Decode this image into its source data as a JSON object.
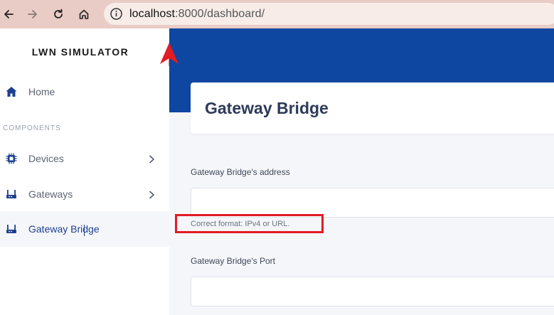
{
  "browser": {
    "url_host": "localhost",
    "url_rest": ":8000/dashboard/",
    "icons": [
      "back-icon",
      "forward-icon",
      "reload-icon",
      "home-icon",
      "info-icon"
    ]
  },
  "sidebar": {
    "brand": "LWN SIMULATOR",
    "section_label": "COMPONENTS",
    "items": [
      {
        "label": "Home",
        "icon": "home-icon",
        "has_chevron": false,
        "active": false
      },
      {
        "label": "Devices",
        "icon": "chip-icon",
        "has_chevron": true,
        "active": false
      },
      {
        "label": "Gateways",
        "icon": "router-icon",
        "has_chevron": true,
        "active": false
      },
      {
        "label": "Gateway Bridge",
        "icon": "router-icon",
        "has_chevron": false,
        "active": true
      }
    ]
  },
  "main": {
    "title": "Gateway Bridge",
    "fields": [
      {
        "label": "Gateway Bridge's address",
        "value": "",
        "hint": "Correct format: IPv4 or URL."
      },
      {
        "label": "Gateway Bridge's Port",
        "value": ""
      }
    ]
  },
  "colors": {
    "banner": "#0d47a1",
    "accent": "#1d3f8f",
    "highlight": "#e21b24",
    "browser_bar": "#e9ccc5"
  }
}
